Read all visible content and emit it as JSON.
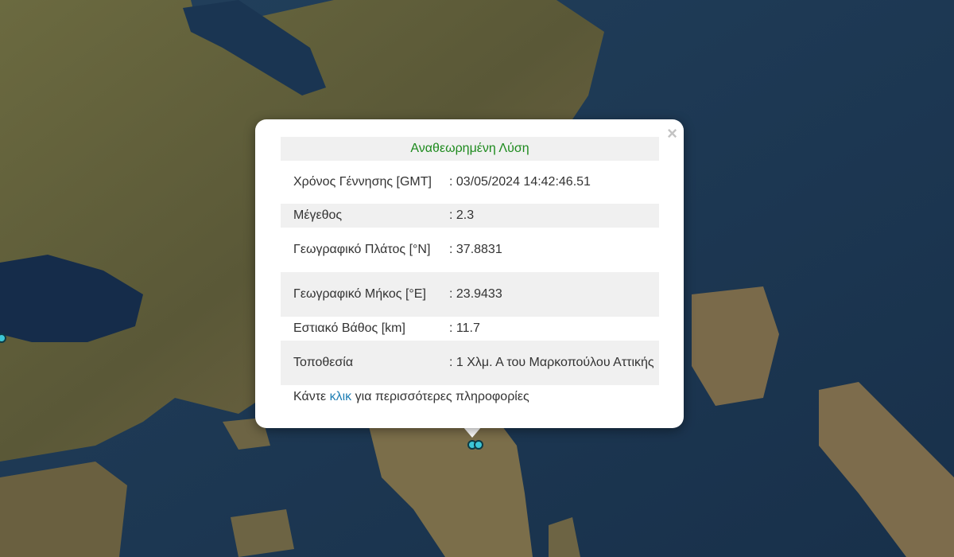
{
  "popup": {
    "title": "Αναθεωρημένη Λύση",
    "close_symbol": "×",
    "rows": [
      {
        "label": "Χρόνος Γέννησης [GMT]",
        "value": ": 03/05/2024 14:42:46.51"
      },
      {
        "label": "Μέγεθος",
        "value": ": 2.3"
      },
      {
        "label": "Γεωγραφικό Πλάτος [°N]",
        "value": ": 37.8831"
      },
      {
        "label": "Γεωγραφικό Μήκος [°E]",
        "value": ": 23.9433"
      },
      {
        "label": "Εστιακό Βάθος [km]",
        "value": ": 11.7"
      },
      {
        "label": "Τοποθεσία",
        "value": ": 1 Χλμ. Α του Μαρκοπούλου Αττικής"
      }
    ],
    "more_prefix": "Κάντε ",
    "more_link": "κλικ",
    "more_suffix": " για περισσότερες πληροφορίες"
  },
  "colors": {
    "sea": "#1c3550",
    "land": "#5f5a3c",
    "marker": "#3cc6d6",
    "title_green": "#1d8a1d",
    "link_blue": "#1f7fb5"
  }
}
